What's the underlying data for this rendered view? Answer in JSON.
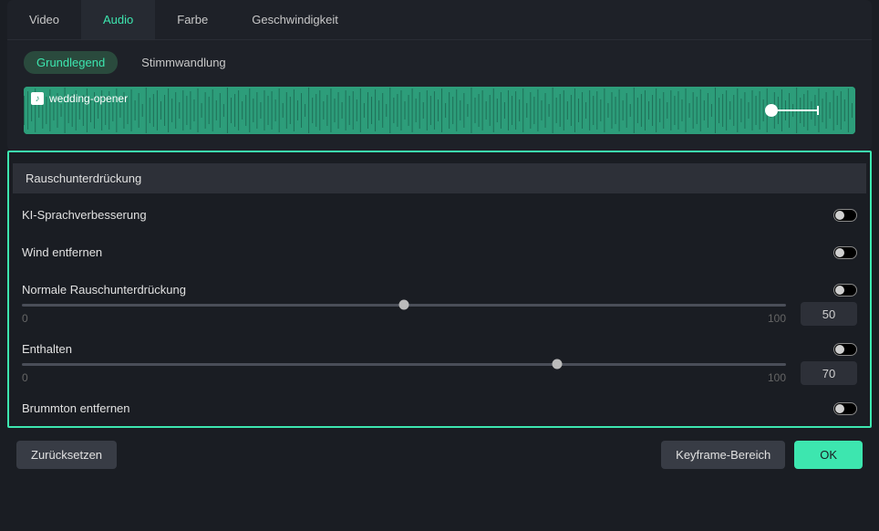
{
  "tabs": {
    "video": "Video",
    "audio": "Audio",
    "farbe": "Farbe",
    "geschwindigkeit": "Geschwindigkeit",
    "active": "audio"
  },
  "subtabs": {
    "grundlegend": "Grundlegend",
    "stimmwandlung": "Stimmwandlung",
    "active": "grundlegend"
  },
  "clip": {
    "name": "wedding-opener"
  },
  "noise": {
    "section_title": "Rauschunterdrückung",
    "ki_speech": {
      "label": "KI-Sprachverbesserung",
      "enabled": false
    },
    "wind": {
      "label": "Wind entfernen",
      "enabled": false
    },
    "normal": {
      "label": "Normale Rauschunterdrückung",
      "enabled": false,
      "value": "50",
      "min": "0",
      "max": "100",
      "percent": 50
    },
    "dereverb": {
      "label": "Enthalten",
      "enabled": false,
      "value": "70",
      "min": "0",
      "max": "100",
      "percent": 70
    },
    "hum": {
      "label": "Brummton entfernen",
      "enabled": false
    }
  },
  "footer": {
    "reset": "Zurücksetzen",
    "keyframe": "Keyframe-Bereich",
    "ok": "OK"
  }
}
